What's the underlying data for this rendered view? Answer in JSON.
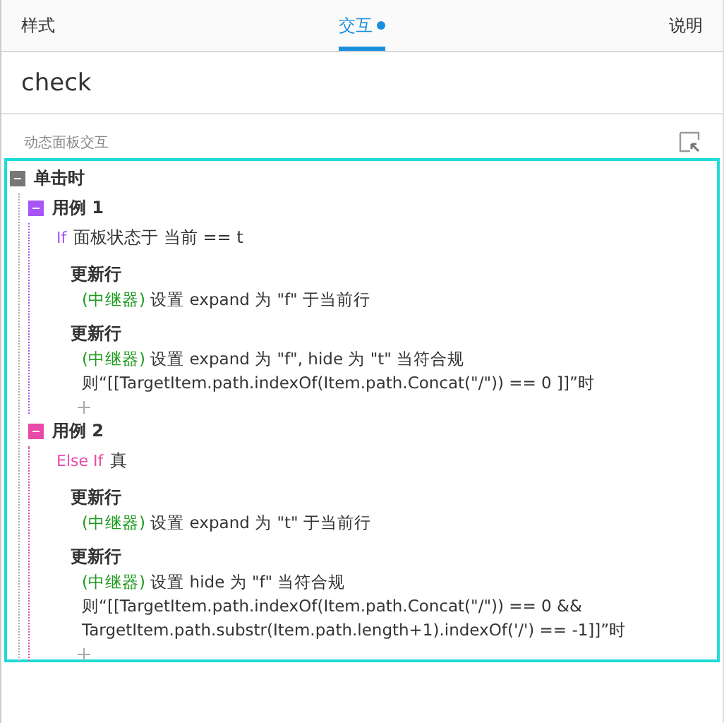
{
  "tabs": [
    {
      "label": "样式",
      "selected": false,
      "marked": false
    },
    {
      "label": "交互",
      "selected": true,
      "marked": true
    },
    {
      "label": "说明",
      "selected": false,
      "marked": false
    }
  ],
  "widget_name": "check",
  "section_label": "动态面板交互",
  "event": {
    "title": "单击时",
    "expanded": true,
    "cases": [
      {
        "title": "用例 1",
        "color": "#a855f7",
        "expanded": true,
        "condition": {
          "kind": "if",
          "keyword": "If",
          "text": "面板状态于 当前 == t"
        },
        "actions": [
          {
            "title": "更新行",
            "target": "(中继器)",
            "text": "设置 expand 为 \"f\" 于当前行"
          },
          {
            "title": "更新行",
            "target": "(中继器)",
            "text": "设置 expand 为 \"f\", hide 为 \"t\" 当符合规则“[[TargetItem.path.indexOf(Item.path.Concat(\"/\")) == 0 ]]”时"
          }
        ]
      },
      {
        "title": "用例 2",
        "color": "#e84aa8",
        "expanded": true,
        "condition": {
          "kind": "elseif",
          "keyword": "Else If",
          "text": "真"
        },
        "actions": [
          {
            "title": "更新行",
            "target": "(中继器)",
            "text": "设置 expand 为 \"t\" 于当前行"
          },
          {
            "title": "更新行",
            "target": "(中继器)",
            "text": "设置 hide 为 \"f\" 当符合规则“[[TargetItem.path.indexOf(Item.path.Concat(\"/\")) == 0 && TargetItem.path.substr(Item.path.length+1).indexOf('/') == -1]]”时"
          }
        ]
      }
    ]
  }
}
